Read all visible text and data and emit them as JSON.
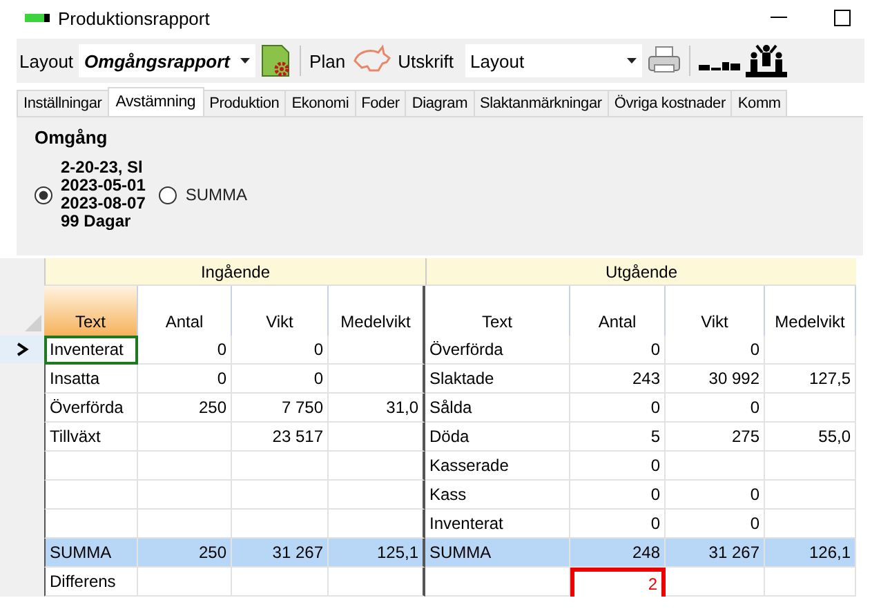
{
  "window": {
    "title": "Produktionsrapport"
  },
  "toolbar": {
    "layout_label": "Layout",
    "layout_value": "Omgångsrapport",
    "plan_label": "Plan",
    "print_label": "Utskrift",
    "print_value": "Layout"
  },
  "tabs": [
    {
      "label": "Inställningar",
      "selected": false
    },
    {
      "label": "Avstämning",
      "selected": true
    },
    {
      "label": "Produktion",
      "selected": false
    },
    {
      "label": "Ekonomi",
      "selected": false
    },
    {
      "label": "Foder",
      "selected": false
    },
    {
      "label": "Diagram",
      "selected": false
    },
    {
      "label": "Slaktanmärkningar",
      "selected": false
    },
    {
      "label": "Övriga kostnader",
      "selected": false
    },
    {
      "label": "Komm",
      "selected": false
    }
  ],
  "round": {
    "title": "Omgång",
    "options": [
      {
        "kind": "round",
        "lines": [
          "2-20-23, Sl",
          "2023-05-01",
          "2023-08-07",
          "99 Dagar"
        ],
        "selected": true
      },
      {
        "kind": "total",
        "lines": [
          "SUMMA"
        ],
        "selected": false
      }
    ]
  },
  "grid": {
    "groups": [
      "Ingående",
      "Utgående"
    ],
    "columns_in": [
      {
        "label": "Text",
        "selected": true
      },
      {
        "label": "Antal",
        "selected": false
      },
      {
        "label": "Vikt",
        "selected": false
      },
      {
        "label": "Medelvikt",
        "selected": false
      }
    ],
    "columns_out": [
      {
        "label": "Text",
        "selected": false
      },
      {
        "label": "Antal",
        "selected": false
      },
      {
        "label": "Vikt",
        "selected": false
      },
      {
        "label": "Medelvikt",
        "selected": false
      }
    ],
    "rows": [
      {
        "kind": "data",
        "current": true,
        "in": {
          "text": "Inventerat",
          "antal": "0",
          "vikt": "0"
        },
        "out": {
          "text": "Överförda",
          "antal": "0",
          "vikt": "0"
        }
      },
      {
        "kind": "data",
        "current": false,
        "in": {
          "text": "Insatta",
          "antal": "0",
          "vikt": "0"
        },
        "out": {
          "text": "Slaktade",
          "antal": "243",
          "vikt": "30 992",
          "medelvikt": "127,5"
        }
      },
      {
        "kind": "data",
        "current": false,
        "in": {
          "text": "Överförda",
          "antal": "250",
          "vikt": "7 750",
          "medelvikt": "31,0"
        },
        "out": {
          "text": "Sålda",
          "antal": "0",
          "vikt": "0"
        }
      },
      {
        "kind": "data",
        "current": false,
        "in": {
          "text": "Tillväxt",
          "vikt": "23 517"
        },
        "out": {
          "text": "Döda",
          "antal": "5",
          "vikt": "275",
          "medelvikt": "55,0"
        }
      },
      {
        "kind": "data",
        "current": false,
        "out": {
          "text": "Kasserade",
          "antal": "0"
        }
      },
      {
        "kind": "data",
        "current": false,
        "out": {
          "text": "Kass",
          "antal": "0",
          "vikt": "0"
        }
      },
      {
        "kind": "data",
        "current": false,
        "out": {
          "text": "Inventerat",
          "antal": "0",
          "vikt": "0"
        }
      },
      {
        "kind": "sum",
        "current": false,
        "in": {
          "text": "SUMMA",
          "antal": "250",
          "vikt": "31 267",
          "medelvikt": "125,1"
        },
        "out": {
          "text": "SUMMA",
          "antal": "248",
          "vikt": "31 267",
          "medelvikt": "126,1"
        }
      },
      {
        "kind": "data",
        "current": false,
        "in": {
          "text": "Differens"
        },
        "out": {
          "antal": {
            "value": "2",
            "flagged": true
          }
        }
      }
    ]
  }
}
